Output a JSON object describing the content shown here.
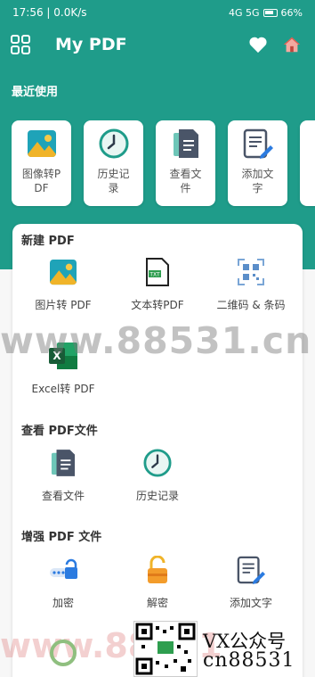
{
  "status": {
    "time_speed": "17:56 | 0.0K/s",
    "signals": "4G 5G",
    "battery": "66%"
  },
  "appbar": {
    "title": "My PDF",
    "icons": [
      "grid-menu-icon",
      "heart-icon",
      "home-icon"
    ]
  },
  "recent": {
    "label": "最近使用",
    "items": [
      {
        "label": "图像转PDF",
        "icon": "image-icon"
      },
      {
        "label": "历史记录",
        "icon": "clock-icon"
      },
      {
        "label": "查看文件",
        "icon": "document-icon"
      },
      {
        "label": "添加文字",
        "icon": "edit-document-icon"
      }
    ]
  },
  "new_pdf": {
    "title": "新建 PDF",
    "tools": [
      {
        "label": "图片转 PDF",
        "icon": "image-icon"
      },
      {
        "label": "文本转PDF",
        "icon": "txt-file-icon"
      },
      {
        "label": "二维码 & 条码",
        "icon": "qr-scan-icon"
      },
      {
        "label": "Excel转 PDF",
        "icon": "excel-icon"
      }
    ]
  },
  "view_pdf": {
    "title": "查看 PDF文件",
    "tools": [
      {
        "label": "查看文件",
        "icon": "document-icon"
      },
      {
        "label": "历史记录",
        "icon": "clock-icon"
      }
    ]
  },
  "enhance_pdf": {
    "title": "增强 PDF 文件",
    "tools": [
      {
        "label": "加密",
        "icon": "password-lock-icon"
      },
      {
        "label": "解密",
        "icon": "unlock-icon"
      },
      {
        "label": "添加文字",
        "icon": "edit-document-icon"
      }
    ]
  },
  "watermarks": {
    "middle": "www.88531.cn",
    "bottom": "www.88531",
    "vx": "VX公众号",
    "cn": "cn88531"
  },
  "colors": {
    "brand": "#1f9c8a",
    "accent_green": "#3bb58e"
  }
}
